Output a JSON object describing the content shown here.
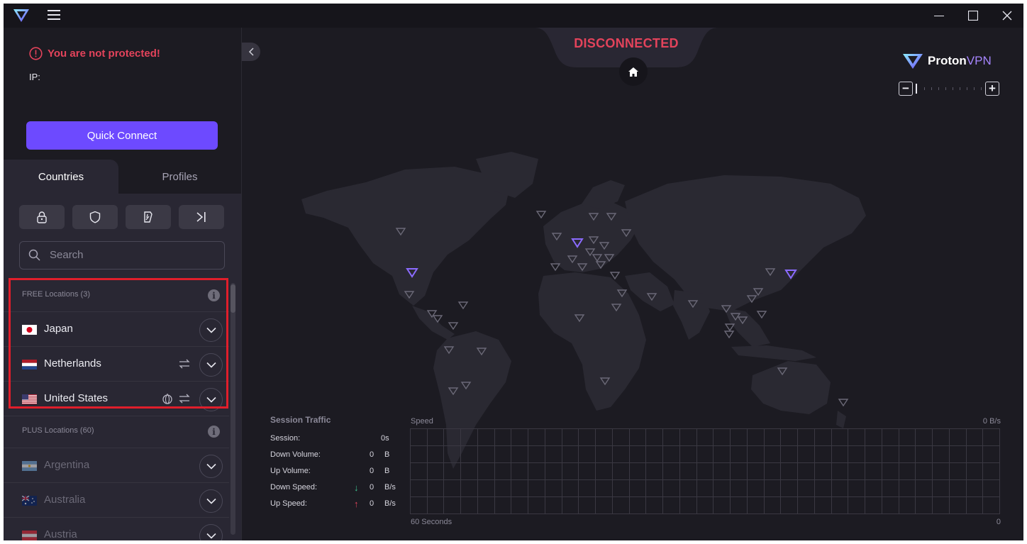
{
  "titlebar": {
    "icons": [
      "protonvpn-logo-icon",
      "hamburger-menu-icon",
      "minimize-icon",
      "maximize-icon",
      "close-icon"
    ]
  },
  "status": {
    "protection": "You are not protected!",
    "ip_label": "IP:",
    "quick_connect": "Quick Connect"
  },
  "tabs": [
    {
      "label": "Countries",
      "active": true
    },
    {
      "label": "Profiles",
      "active": false
    }
  ],
  "filters": [
    "secure-core-lock-icon",
    "shield-icon",
    "p2p-icon",
    "tor-icon"
  ],
  "search": {
    "placeholder": "Search"
  },
  "sections": {
    "free": "FREE Locations (3)",
    "plus": "PLUS Locations (60)"
  },
  "free_countries": [
    {
      "name": "Japan",
      "features": []
    },
    {
      "name": "Netherlands",
      "features": [
        "p2p"
      ]
    },
    {
      "name": "United States",
      "features": [
        "tor",
        "p2p"
      ]
    }
  ],
  "plus_countries": [
    {
      "name": "Argentina"
    },
    {
      "name": "Australia"
    },
    {
      "name": "Austria"
    }
  ],
  "map": {
    "connection_status": "DISCONNECTED",
    "brand_prefix": "Proton",
    "brand_suffix": "VPN",
    "zoom_level": 0
  },
  "traffic": {
    "title": "Session Traffic",
    "rows": [
      {
        "label": "Session:",
        "value": "0s",
        "unit": ""
      },
      {
        "label": "Down Volume:",
        "value": "0",
        "unit": "B"
      },
      {
        "label": "Up Volume:",
        "value": "0",
        "unit": "B"
      },
      {
        "label": "Down Speed:",
        "value": "0",
        "unit": "B/s"
      },
      {
        "label": "Up Speed:",
        "value": "0",
        "unit": "B/s"
      }
    ]
  },
  "speed_chart": {
    "label": "Speed",
    "max": "0 B/s",
    "x_label": "60 Seconds",
    "zero": "0"
  },
  "colors": {
    "accent": "#6d4aff",
    "danger": "#e3435b",
    "background": "#1c1b22",
    "panel": "#292733",
    "highlight_box": "#e01e2b"
  }
}
